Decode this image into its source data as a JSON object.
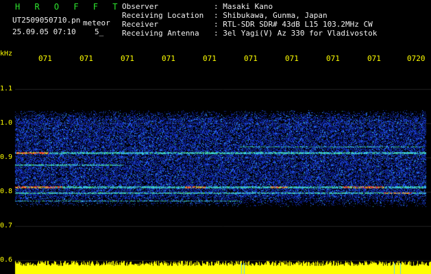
{
  "title": "H R O F F T",
  "file_name": "UT2509050710.pn",
  "mode": "meteor",
  "datetime": "25.09.05 07:10",
  "count": "5_",
  "info": [
    {
      "key": "Observer",
      "value": ": Masaki Kano"
    },
    {
      "key": "Receiving Location",
      "value": ": Shibukawa, Gunma, Japan"
    },
    {
      "key": "Receiver",
      "value": ": RTL-SDR SDR# 43dB L15 103.2MHz CW"
    },
    {
      "key": "Receiving Antenna",
      "value": ": 3el Yagi(V) Az 330 for Vladivostok"
    }
  ],
  "y_unit": "kHz",
  "y_ticks": [
    "1.1",
    "1.0",
    "0.9",
    "0.8",
    "0.7",
    "0.6"
  ],
  "x_ticks": [
    "071",
    "071",
    "071",
    "071",
    "071",
    "071",
    "071",
    "071",
    "071",
    "0720"
  ],
  "colors": {
    "background": "#000000",
    "text": "#f2f2f2",
    "label": "#ffff00",
    "title": "#2ee62e",
    "noise": "#1a3dd6",
    "strong": "#ff3030",
    "baseline": "#ffff00"
  }
}
